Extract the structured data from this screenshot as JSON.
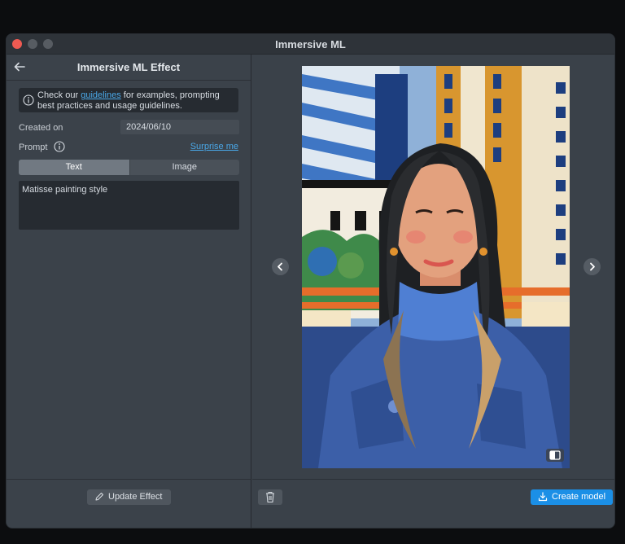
{
  "window": {
    "title": "Immersive ML"
  },
  "left_panel": {
    "title": "Immersive ML Effect",
    "info": {
      "prefix": "Check our ",
      "link_text": "guidelines",
      "suffix": " for examples, prompting best practices and usage guidelines."
    },
    "created_on_label": "Created on",
    "created_on_value": "2024/06/10",
    "prompt_label": "Prompt",
    "surprise_link": "Surprise me",
    "tabs": [
      {
        "label": "Text",
        "active": true
      },
      {
        "label": "Image",
        "active": false
      }
    ],
    "prompt_text": "Matisse painting style",
    "update_button": "Update Effect"
  },
  "right_panel": {
    "create_button": "Create model"
  },
  "colors": {
    "accent": "#1b8fe6",
    "link": "#4aa8e8",
    "close": "#ee5a52"
  }
}
